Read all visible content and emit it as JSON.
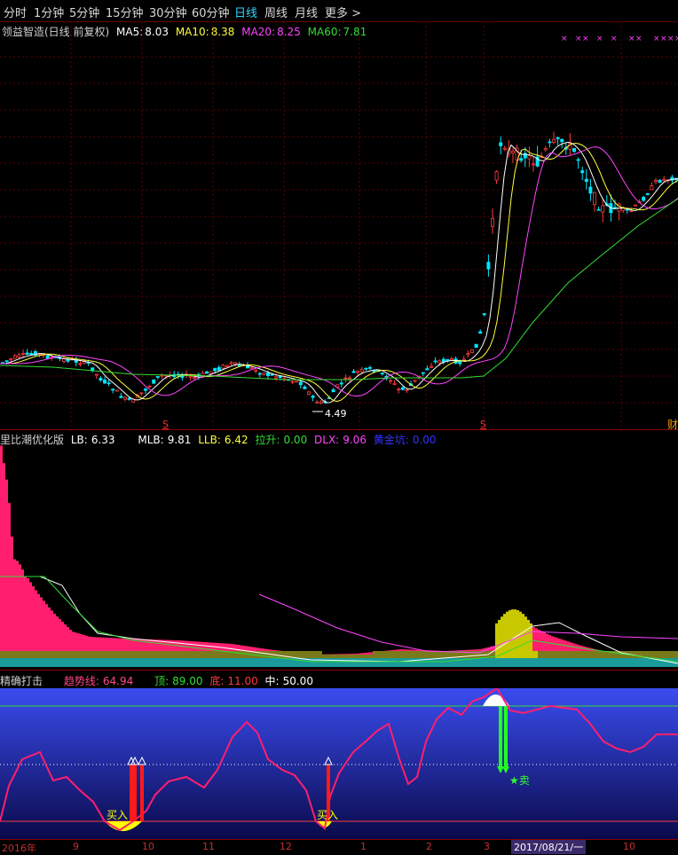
{
  "toolbar": {
    "items": [
      "分时",
      "1分钟",
      "5分钟",
      "15分钟",
      "30分钟",
      "60分钟",
      "日线",
      "周线",
      "月线",
      "更多 >"
    ],
    "active_index": 6
  },
  "main_panel": {
    "stock_name": "领益智造(日线 前复权)",
    "ma5_label": "MA5:",
    "ma5_value": "8.03",
    "ma10_label": "MA10:",
    "ma10_value": "8.38",
    "ma20_label": "MA20:",
    "ma20_value": "8.25",
    "ma60_label": "MA60:",
    "ma60_value": "7.81",
    "low_marker": "4.49",
    "right_cut_label": "财",
    "s_marker": "S"
  },
  "panel2": {
    "title": "里比潮优化版",
    "lb_label": "LB:",
    "lb_value": "6.33",
    "mlb_label": "MLB:",
    "mlb_value": "9.81",
    "llb_label": "LLB:",
    "llb_value": "6.42",
    "lasheng_label": "拉升:",
    "lasheng_value": "0.00",
    "dlx_label": "DLX:",
    "dlx_value": "9.06",
    "huangjin_label": "黄金坑:",
    "huangjin_value": "0.00"
  },
  "panel3": {
    "title": "精确打击",
    "trend_label": "趋势线:",
    "trend_value": "64.94",
    "top_label": "顶:",
    "top_value": "89.00",
    "bottom_label": "底:",
    "bottom_value": "11.00",
    "mid_label": "中:",
    "mid_value": "50.00",
    "buy_text": "买入",
    "sell_text": "★卖"
  },
  "time_axis": {
    "labels": [
      "2016年",
      "9",
      "10",
      "11",
      "12",
      "1",
      "2",
      "3",
      "10"
    ],
    "cursor_date": "2017/08/21/一"
  },
  "colors": {
    "up": "#ff3b3b",
    "down": "#00e5ff",
    "ma5": "#ffffff",
    "ma10": "#ffff3b",
    "ma20": "#ff44ff",
    "ma60": "#33dd33",
    "pink": "#ff1f6e",
    "olive": "#c8c800"
  }
}
